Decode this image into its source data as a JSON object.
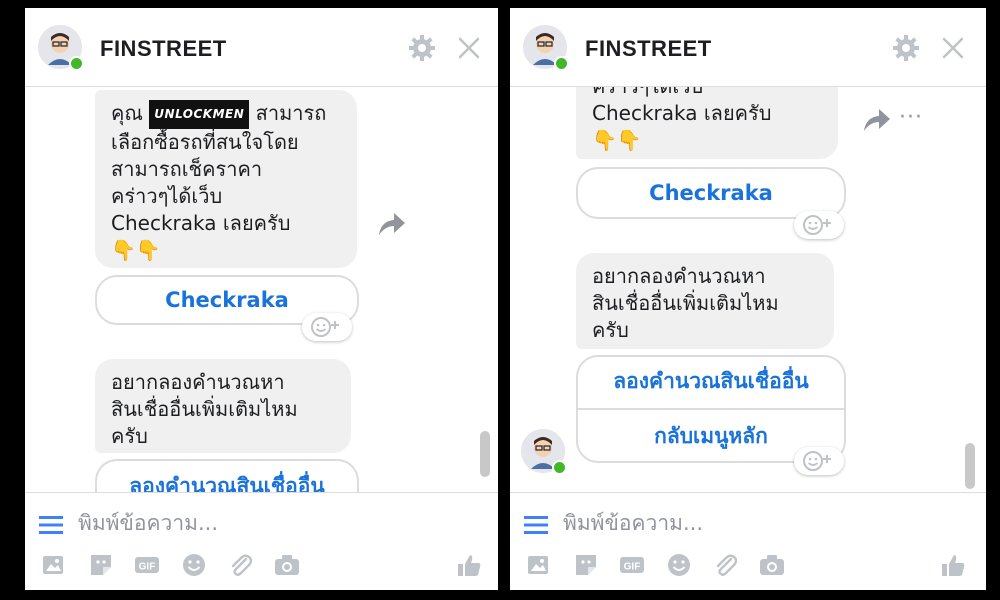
{
  "app_title": "FINSTREET",
  "left": {
    "message1": {
      "pre": "คุณ",
      "brand": "UNLOCKMEN",
      "line1_rest": "สามารถ",
      "line2": "เลือกซื้อรถที่สนใจโดย",
      "line3": "สามารถเช็คราคา",
      "line4": "คร่าวๆได้เว็บ",
      "line5": "Checkraka เลยครับ",
      "line6": "👇👇"
    },
    "quick_reply": "Checkraka",
    "message2": {
      "line1": "อยากลองคำนวณหา",
      "line2": "สินเชื่ออื่นเพิ่มเติมไหม",
      "line3": "ครับ"
    },
    "option1": "ลองคำนวณสินเชื่ออื่น"
  },
  "right": {
    "message1": {
      "line0": "คร่าวๆได้เว็บ",
      "line1": "Checkraka เลยครับ",
      "line2": "👇👇"
    },
    "quick_reply": "Checkraka",
    "message2": {
      "line1": "อยากลองคำนวณหา",
      "line2": "สินเชื่ออื่นเพิ่มเติมไหม",
      "line3": "ครับ"
    },
    "option1": "ลองคำนวณสินเชื่ออื่น",
    "option2": "กลับเมนูหลัก",
    "more_dots": "···"
  },
  "compose_placeholder": "พิมพ์ข้อความ...",
  "colors": {
    "link": "#1a73d9",
    "bubble": "#f1f0f0",
    "online": "#42b72a",
    "icon": "#bec3c9"
  },
  "icons": [
    "gear-icon",
    "close-icon",
    "share-icon",
    "smile-add-icon",
    "menu-icon",
    "photo-icon",
    "sticker-icon",
    "gif-icon",
    "emoji-icon",
    "attach-icon",
    "camera-icon",
    "like-icon"
  ]
}
